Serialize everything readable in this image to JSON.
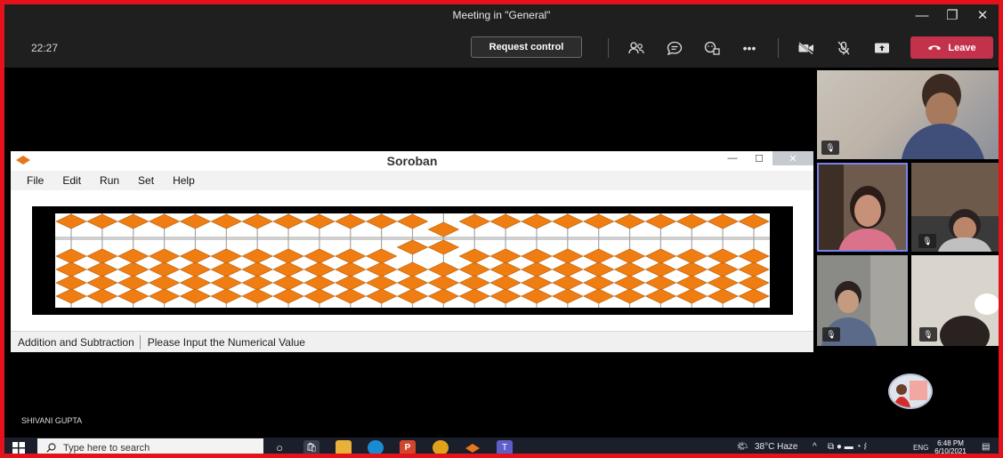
{
  "window": {
    "title": "Meeting in \"General\""
  },
  "meeting": {
    "timer": "22:27",
    "request_control_label": "Request control",
    "leave_label": "Leave"
  },
  "shared_app": {
    "title": "Soroban",
    "menu": [
      "File",
      "Edit",
      "Run",
      "Set",
      "Help"
    ],
    "status_mode": "Addition and Subtraction",
    "status_prompt": "Please Input the Numerical Value",
    "abacus_columns": 23
  },
  "presenter_name": "SHIVANI GUPTA",
  "taskbar": {
    "search_placeholder": "Type here to search",
    "weather": "38°C  Haze",
    "language": "ENG",
    "time": "6:48 PM",
    "date": "6/10/2021"
  },
  "colors": {
    "leave": "#c4314b",
    "bead": "#f07d12",
    "frame": "#e3121b"
  }
}
